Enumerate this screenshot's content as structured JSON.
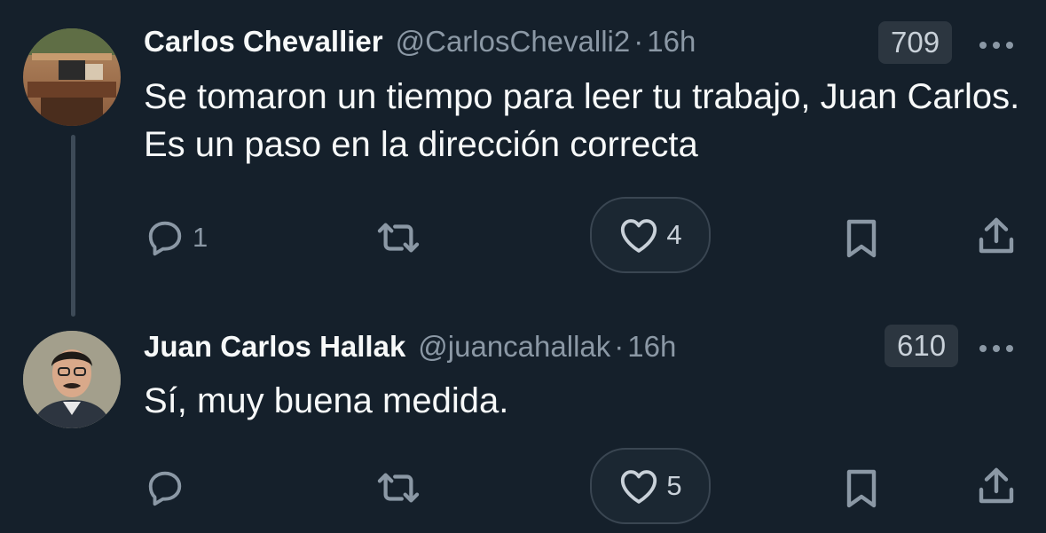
{
  "tweets": [
    {
      "display_name": "Carlos Chevallier",
      "handle": "@CarlosChevalli2",
      "separator": "·",
      "time": "16h",
      "views": "709",
      "text": "Se tomaron un tiempo para leer tu trabajo, Juan Carlos. Es un paso en la dirección correcta",
      "reply_count": "1",
      "retweet_count": "",
      "like_count": "4",
      "avatar": "desk-photo"
    },
    {
      "display_name": "Juan Carlos Hallak",
      "handle": "@juancahallak",
      "separator": "·",
      "time": "16h",
      "views": "610",
      "text": "Sí, muy buena medida.",
      "reply_count": "",
      "retweet_count": "",
      "like_count": "5",
      "avatar": "man-portrait"
    }
  ],
  "colors": {
    "background": "#15202b",
    "text": "#f7f9f9",
    "secondary": "#8b98a5"
  },
  "icons": [
    "reply-icon",
    "retweet-icon",
    "like-icon",
    "bookmark-icon",
    "share-icon",
    "more-icon"
  ]
}
